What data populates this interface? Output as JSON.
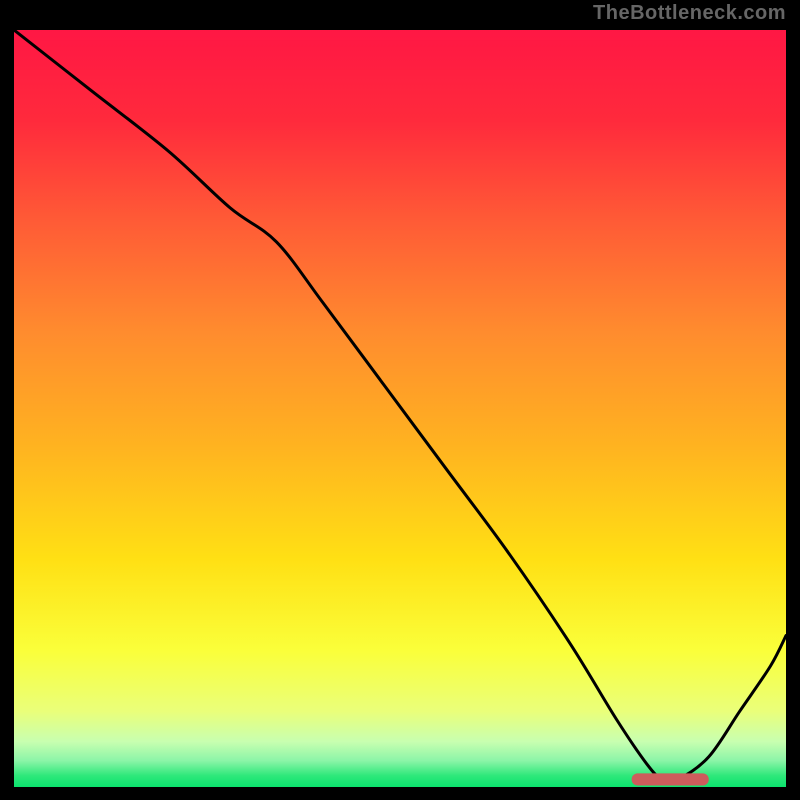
{
  "watermark": "TheBottleneck.com",
  "chart_data": {
    "type": "line",
    "title": "",
    "xlabel": "",
    "ylabel": "",
    "xlim": [
      0,
      100
    ],
    "ylim": [
      0,
      100
    ],
    "grid": false,
    "legend": false,
    "annotations": [],
    "series": [
      {
        "name": "curve",
        "color": "#000000",
        "x": [
          0,
          10,
          20,
          28,
          34,
          40,
          48,
          56,
          64,
          72,
          78,
          82,
          84,
          86,
          90,
          94,
          98,
          100
        ],
        "y": [
          100,
          92,
          84,
          76.5,
          72,
          64,
          53,
          42,
          31,
          19,
          9,
          3,
          1.0,
          1.0,
          4,
          10,
          16,
          20
        ]
      }
    ],
    "optimal_marker": {
      "name": "optimal-range-bar",
      "color": "#cd5c5c",
      "x_start": 80,
      "x_end": 90,
      "y": 1,
      "thickness_pct": 1.6
    },
    "background_gradient": {
      "stops": [
        {
          "offset": 0.0,
          "color": "#ff1744"
        },
        {
          "offset": 0.12,
          "color": "#ff2a3c"
        },
        {
          "offset": 0.25,
          "color": "#ff5a36"
        },
        {
          "offset": 0.4,
          "color": "#ff8c2e"
        },
        {
          "offset": 0.55,
          "color": "#ffb320"
        },
        {
          "offset": 0.7,
          "color": "#ffe014"
        },
        {
          "offset": 0.82,
          "color": "#faff3a"
        },
        {
          "offset": 0.9,
          "color": "#eaff7a"
        },
        {
          "offset": 0.94,
          "color": "#c8ffb0"
        },
        {
          "offset": 0.965,
          "color": "#8cf5a8"
        },
        {
          "offset": 0.985,
          "color": "#2ee87a"
        },
        {
          "offset": 1.0,
          "color": "#0be36e"
        }
      ]
    }
  }
}
